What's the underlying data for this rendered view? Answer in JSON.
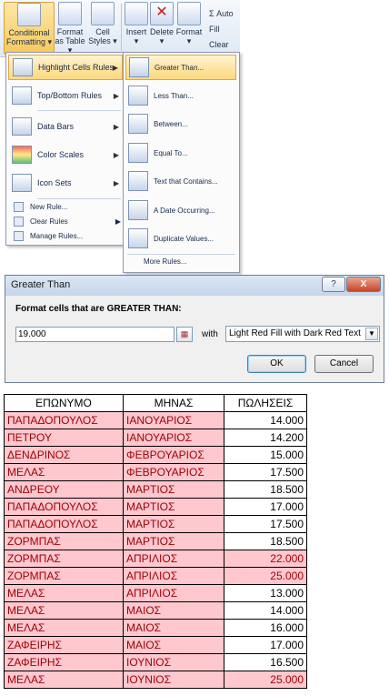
{
  "ribbon": {
    "conditional_formatting": "Conditional Formatting",
    "format_as_table": "Format as Table",
    "cell_styles": "Cell Styles",
    "insert": "Insert",
    "delete": "Delete",
    "format": "Format",
    "autosum": "Σ Auto",
    "fill": "Fill",
    "clear": "Clear"
  },
  "menu": {
    "highlight": "Highlight Cells Rules",
    "topbottom": "Top/Bottom Rules",
    "databars": "Data Bars",
    "colorscales": "Color Scales",
    "iconsets": "Icon Sets",
    "newrule": "New Rule...",
    "clearrules": "Clear Rules",
    "managerules": "Manage Rules..."
  },
  "submenu": {
    "greater": "Greater Than...",
    "less": "Less Than...",
    "between": "Between...",
    "equal": "Equal To...",
    "text": "Text that Contains...",
    "date": "A Date Occurring...",
    "duplicate": "Duplicate Values...",
    "more": "More Rules..."
  },
  "dialog": {
    "title": "Greater Than",
    "help": "?",
    "close": "X",
    "label": "Format cells that are GREATER THAN:",
    "value": "19.000",
    "with": "with",
    "format": "Light Red Fill with Dark Red Text",
    "ok": "OK",
    "cancel": "Cancel"
  },
  "table": {
    "headers": [
      "ΕΠΩΝΥΜΟ",
      "ΜΗΝΑΣ",
      "ΠΩΛΗΣΕΙΣ"
    ],
    "rows": [
      [
        "ΠΑΠΑΔΟΠΟΥΛΟΣ",
        "ΙΑΝΟΥΑΡΙΟΣ",
        "14.000"
      ],
      [
        "ΠΕΤΡΟΥ",
        "ΙΑΝΟΥΑΡΙΟΣ",
        "14.200"
      ],
      [
        "ΔΕΝΔΡΙΝΟΣ",
        "ΦΕΒΡΟΥΑΡΙΟΣ",
        "15.000"
      ],
      [
        "ΜΕΛΑΣ",
        "ΦΕΒΡΟΥΑΡΙΟΣ",
        "17.500"
      ],
      [
        "ΑΝΔΡΕΟΥ",
        "ΜΑΡΤΙΟΣ",
        "18.500"
      ],
      [
        "ΠΑΠΑΔΟΠΟΥΛΟΣ",
        "ΜΑΡΤΙΟΣ",
        "17.000"
      ],
      [
        "ΠΑΠΑΔΟΠΟΥΛΟΣ",
        "ΜΑΡΤΙΟΣ",
        "17.500"
      ],
      [
        "ΖΟΡΜΠΑΣ",
        "ΜΑΡΤΙΟΣ",
        "18.500"
      ],
      [
        "ΖΟΡΜΠΑΣ",
        "ΑΠΡΙΛΙΟΣ",
        "22.000"
      ],
      [
        "ΖΟΡΜΠΑΣ",
        "ΑΠΡΙΛΙΟΣ",
        "25.000"
      ],
      [
        "ΜΕΛΑΣ",
        "ΑΠΡΙΛΙΟΣ",
        "13.000"
      ],
      [
        "ΜΕΛΑΣ",
        "ΜΑΙΟΣ",
        "14.000"
      ],
      [
        "ΜΕΛΑΣ",
        "ΜΑΙΟΣ",
        "16.000"
      ],
      [
        "ΖΑΦΕΙΡΗΣ",
        "ΜΑΙΟΣ",
        "17.000"
      ],
      [
        "ΖΑΦΕΙΡΗΣ",
        "ΙΟΥΝΙΟΣ",
        "16.500"
      ],
      [
        "ΜΕΛΑΣ",
        "ΙΟΥΝΙΟΣ",
        "25.000"
      ]
    ],
    "highlighted_sales": [
      "22.000",
      "25.000"
    ],
    "highlight_fill": "#ffc7ce",
    "highlight_text": "#9c0006"
  }
}
